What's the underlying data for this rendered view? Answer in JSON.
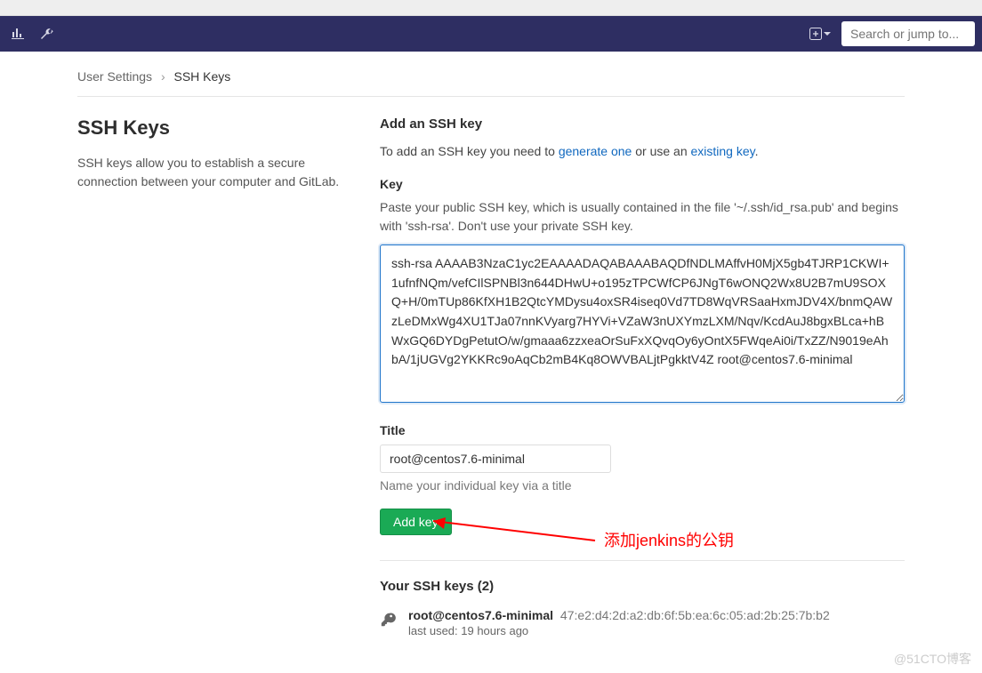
{
  "nav": {
    "search_placeholder": "Search or jump to..."
  },
  "breadcrumb": {
    "a": "User Settings",
    "b": "SSH Keys"
  },
  "side": {
    "title": "SSH Keys",
    "desc": "SSH keys allow you to establish a secure connection between your computer and GitLab."
  },
  "form": {
    "section_title": "Add an SSH key",
    "help_pre": "To add an SSH key you need to ",
    "help_link1": "generate one",
    "help_mid": " or use an ",
    "help_link2": "existing key",
    "help_post": ".",
    "key_label": "Key",
    "key_hint": "Paste your public SSH key, which is usually contained in the file '~/.ssh/id_rsa.pub' and begins with 'ssh-rsa'. Don't use your private SSH key.",
    "key_value": "ssh-rsa AAAAB3NzaC1yc2EAAAADAQABAAABAQDfNDLMAffvH0MjX5gb4TJRP1CKWI+1ufnfNQm/vefCIlSPNBl3n644DHwU+o195zTPCWfCP6JNgT6wONQ2Wx8U2B7mU9SOXQ+H/0mTUp86KfXH1B2QtcYMDysu4oxSR4iseq0Vd7TD8WqVRSaaHxmJDV4X/bnmQAWzLeDMxWg4XU1TJa07nnKVyarg7HYVi+VZaW3nUXYmzLXM/Nqv/KcdAuJ8bgxBLca+hBWxGQ6DYDgPetutO/w/gmaaa6zzxeaOrSuFxXQvqOy6yOntX5FWqeAi0i/TxZZ/N9019eAhbA/1jUGVg2YKKRc9oAqCb2mB4Kq8OWVBALjtPgkktV4Z root@centos7.6-minimal",
    "title_label": "Title",
    "title_value": "root@centos7.6-minimal",
    "title_hint": "Name your individual key via a title",
    "add_btn": "Add key"
  },
  "list": {
    "heading": "Your SSH keys (2)",
    "items": [
      {
        "name": "root@centos7.6-minimal",
        "fingerprint": "47:e2:d4:2d:a2:db:6f:5b:ea:6c:05:ad:2b:25:7b:b2",
        "meta": "last used: 19 hours ago"
      }
    ]
  },
  "annotation": {
    "text": "添加jenkins的公钥"
  },
  "watermark": "@51CTO博客"
}
